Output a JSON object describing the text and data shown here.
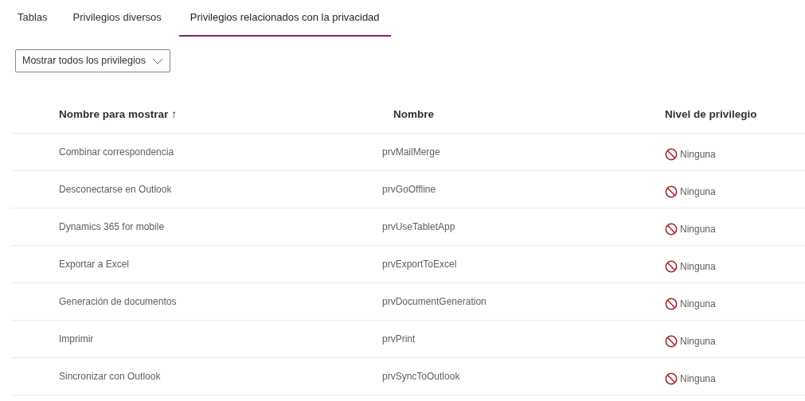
{
  "tabs": [
    {
      "label": "Tablas",
      "selected": false
    },
    {
      "label": "Privilegios diversos",
      "selected": false
    },
    {
      "label": "Privilegios relacionados con la privacidad",
      "selected": true
    }
  ],
  "filter": {
    "value": "Mostrar todos los privilegios"
  },
  "table": {
    "columns": [
      {
        "label": "Nombre para mostrar",
        "sort_indicator": "↑"
      },
      {
        "label": "Nombre"
      },
      {
        "label": "Nivel de privilegio"
      }
    ],
    "rows": [
      {
        "display_name": "Combinar correspondencia",
        "name": "prvMailMerge",
        "level": {
          "kind": "none",
          "label": "Ninguna"
        }
      },
      {
        "display_name": "Desconectarse en Outlook",
        "name": "prvGoOffline",
        "level": {
          "kind": "none",
          "label": "Ninguna"
        }
      },
      {
        "display_name": "Dynamics 365 for mobile",
        "name": "prvUseTabletApp",
        "level": {
          "kind": "none",
          "label": "Ninguna"
        }
      },
      {
        "display_name": "Exportar a Excel",
        "name": "prvExportToExcel",
        "level": {
          "kind": "none",
          "label": "Ninguna"
        }
      },
      {
        "display_name": "Generación de documentos",
        "name": "prvDocumentGeneration",
        "level": {
          "kind": "none",
          "label": "Ninguna"
        }
      },
      {
        "display_name": "Imprimir",
        "name": "prvPrint",
        "level": {
          "kind": "none",
          "label": "Ninguna"
        }
      },
      {
        "display_name": "Sincronizar con Outlook",
        "name": "prvSyncToOutlook",
        "level": {
          "kind": "none",
          "label": "Ninguna"
        }
      }
    ]
  }
}
